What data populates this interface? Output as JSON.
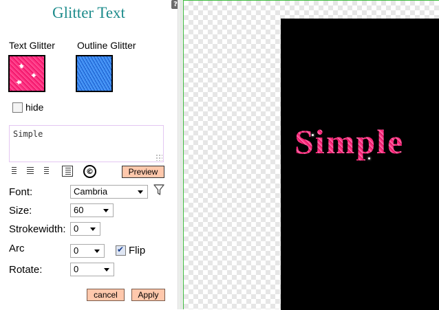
{
  "panel": {
    "title": "Glitter Text",
    "help_label": "?",
    "text_glitter_label": "Text Glitter",
    "outline_glitter_label": "Outline Glitter",
    "hide_label": "hide",
    "hide_checked": false,
    "text_value": "Simple",
    "copyright_symbol": "©",
    "preview_label": "Preview"
  },
  "form": {
    "font_label": "Font:",
    "font_value": "Cambria",
    "size_label": "Size:",
    "size_value": "60",
    "strokewidth_label": "Strokewidth:",
    "strokewidth_value": "0",
    "arc_label": "Arc",
    "arc_value": "0",
    "flip_label": "Flip",
    "flip_checked": true,
    "rotate_label": "Rotate:",
    "rotate_value": "0"
  },
  "actions": {
    "cancel_label": "cancel",
    "apply_label": "Apply"
  },
  "canvas": {
    "text": "Simple",
    "text_color": "#ff2a7f",
    "background": "#000000"
  },
  "colors": {
    "title": "#1e8c8c",
    "button_bg": "#ffc8ac",
    "canvas_border": "#3dbb3d"
  },
  "icons": {
    "help": "help-icon",
    "align_left": "align-left-icon",
    "align_center": "align-center-icon",
    "align_right": "align-right-icon",
    "list": "list-icon",
    "copyright": "copyright-icon",
    "filter": "filter-icon"
  }
}
